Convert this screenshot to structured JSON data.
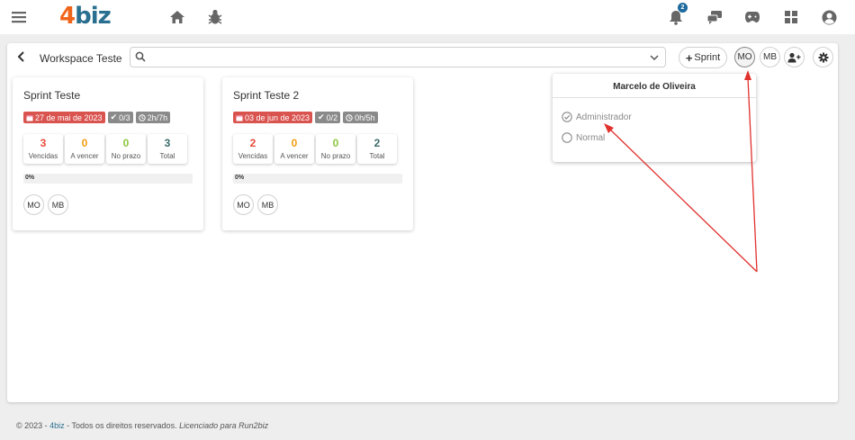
{
  "app": {
    "logo_number": "4",
    "logo_word": "biz",
    "notification_count": "2"
  },
  "topbar_icons": [
    "menu-icon",
    "home-icon",
    "bug-icon",
    "bell-icon",
    "chat-icon",
    "gamepad-icon",
    "apps-grid-icon",
    "user-circle-icon"
  ],
  "workspace": {
    "title": "Workspace Teste",
    "search_placeholder": "",
    "add_sprint_label": "Sprint",
    "members": [
      "MO",
      "MB"
    ]
  },
  "sprints": [
    {
      "title": "Sprint Teste",
      "date": "27 de mai de 2023",
      "tasks": "0/3",
      "hours": "2h/7h",
      "stats": [
        {
          "value": "3",
          "label": "Vencidas",
          "color": "#e74c3c"
        },
        {
          "value": "0",
          "label": "A vencer",
          "color": "#f39c12"
        },
        {
          "value": "0",
          "label": "No prazo",
          "color": "#8dc63f"
        },
        {
          "value": "3",
          "label": "Total",
          "color": "#3d6b6b"
        }
      ],
      "progress_label": "0%",
      "progress": 0,
      "members": [
        "MO",
        "MB"
      ]
    },
    {
      "title": "Sprint Teste 2",
      "date": "03 de jun de 2023",
      "tasks": "0/2",
      "hours": "0h/5h",
      "stats": [
        {
          "value": "2",
          "label": "Vencidas",
          "color": "#e74c3c"
        },
        {
          "value": "0",
          "label": "A vencer",
          "color": "#f39c12"
        },
        {
          "value": "0",
          "label": "No prazo",
          "color": "#8dc63f"
        },
        {
          "value": "2",
          "label": "Total",
          "color": "#3d6b6b"
        }
      ],
      "progress_label": "0%",
      "progress": 0,
      "members": [
        "MO",
        "MB"
      ]
    }
  ],
  "popover": {
    "title": "Marcelo de Oliveira",
    "options": [
      {
        "label": "Administrador",
        "checked": true
      },
      {
        "label": "Normal",
        "checked": false
      }
    ]
  },
  "footer": {
    "prefix": "© 2023 - ",
    "brand": "4biz",
    "middle": " - Todos os direitos reservados. ",
    "license": "Licenciado para Run2biz"
  }
}
